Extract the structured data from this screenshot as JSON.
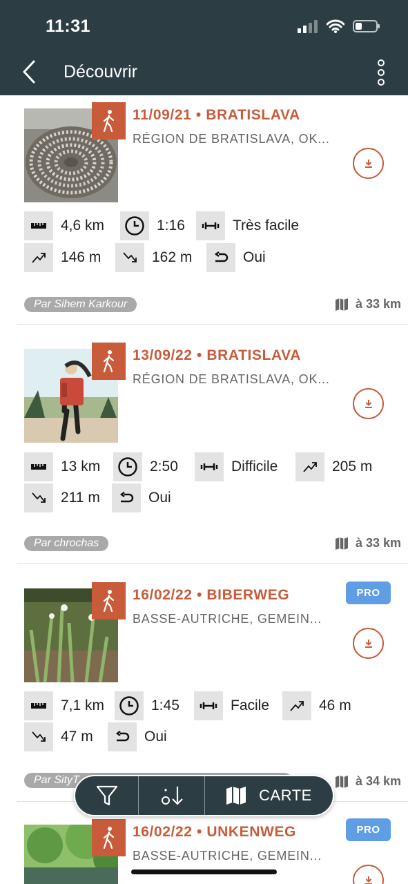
{
  "status_bar": {
    "time": "11:31"
  },
  "nav": {
    "title": "Découvrir"
  },
  "treks": [
    {
      "title": "11/09/21 • BRATISLAVA",
      "region": "RÉGION DE BRATISLAVA, OK...",
      "pro": "",
      "author": "Par Sihem Karkour",
      "distance": "à 33 km",
      "stats": [
        {
          "icon": "ruler-icon",
          "value": "4,6 km"
        },
        {
          "icon": "clock-icon",
          "value": "1:16"
        },
        {
          "icon": "dumbbell-icon",
          "value": "Très facile"
        },
        {
          "icon": "ascent-icon",
          "value": "146 m"
        },
        {
          "icon": "descent-icon",
          "value": "162 m"
        },
        {
          "icon": "loop-icon",
          "value": "Oui"
        }
      ]
    },
    {
      "title": "13/09/22 • BRATISLAVA",
      "region": "RÉGION DE BRATISLAVA, OK...",
      "pro": "",
      "author": "Par chrochas",
      "distance": "à 33 km",
      "stats": [
        {
          "icon": "ruler-icon",
          "value": "13 km"
        },
        {
          "icon": "clock-icon",
          "value": "2:50"
        },
        {
          "icon": "dumbbell-icon",
          "value": "Difficile"
        },
        {
          "icon": "ascent-icon",
          "value": "205 m"
        },
        {
          "icon": "descent-icon",
          "value": "211 m"
        },
        {
          "icon": "loop-icon",
          "value": "Oui"
        }
      ]
    },
    {
      "title": "16/02/22 • BIBERWEG",
      "region": "BASSE-AUTRICHE, GEMEIN...",
      "pro": "PRO",
      "author": "Par SityT",
      "distance": "à 34 km",
      "stats": [
        {
          "icon": "ruler-icon",
          "value": "7,1 km"
        },
        {
          "icon": "clock-icon",
          "value": "1:45"
        },
        {
          "icon": "dumbbell-icon",
          "value": "Facile"
        },
        {
          "icon": "ascent-icon",
          "value": "46 m"
        },
        {
          "icon": "descent-icon",
          "value": "47 m"
        },
        {
          "icon": "loop-icon",
          "value": "Oui"
        }
      ]
    },
    {
      "title": "16/02/22 • UNKENWEG",
      "region": "BASSE-AUTRICHE, GEMEIN...",
      "pro": "PRO"
    }
  ],
  "bottom_bar": {
    "map_label": "CARTE"
  },
  "colors": {
    "header": "#2c3e44",
    "accent": "#c75b3a",
    "pro": "#5f9ee4"
  }
}
